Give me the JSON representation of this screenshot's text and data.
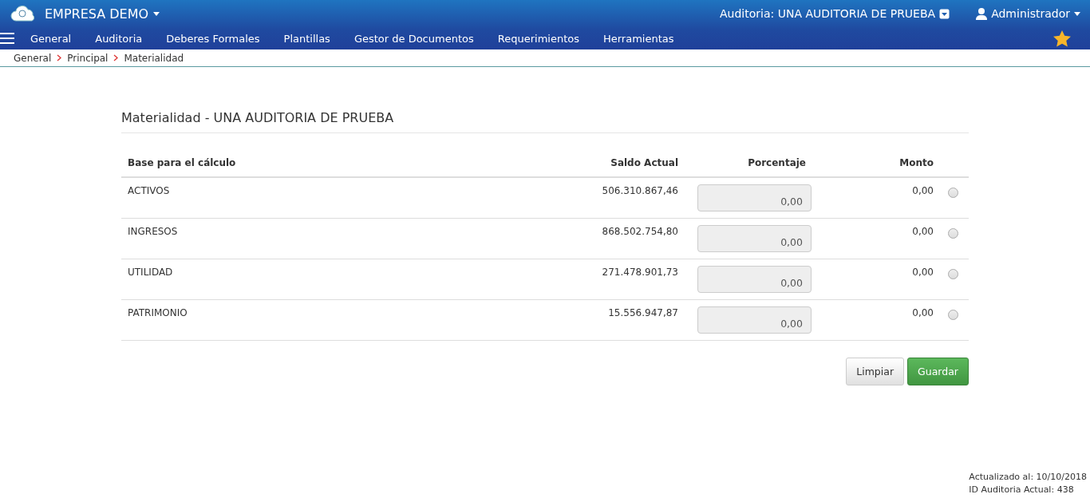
{
  "header": {
    "company": "EMPRESA DEMO",
    "audit": "Auditoria: UNA AUDITORIA DE PRUEBA",
    "user": "Administrador"
  },
  "menu": [
    "General",
    "Auditoria",
    "Deberes Formales",
    "Plantillas",
    "Gestor de Documentos",
    "Requerimientos",
    "Herramientas"
  ],
  "breadcrumb": [
    "General",
    "Principal",
    "Materialidad"
  ],
  "title": "Materialidad - UNA AUDITORIA DE PRUEBA",
  "table": {
    "columns": [
      "Base para el cálculo",
      "Saldo Actual",
      "Porcentaje",
      "Monto"
    ],
    "rows": [
      {
        "base": "ACTIVOS",
        "saldo": "506.310.867,46",
        "porcentaje": "0,00",
        "monto": "0,00",
        "selected": false
      },
      {
        "base": "INGRESOS",
        "saldo": "868.502.754,80",
        "porcentaje": "0,00",
        "monto": "0,00",
        "selected": false
      },
      {
        "base": "UTILIDAD",
        "saldo": "271.478.901,73",
        "porcentaje": "0,00",
        "monto": "0,00",
        "selected": false
      },
      {
        "base": "PATRIMONIO",
        "saldo": "15.556.947,87",
        "porcentaje": "0,00",
        "monto": "0,00",
        "selected": false
      }
    ]
  },
  "buttons": [
    "Limpiar",
    "Guardar"
  ],
  "footer": [
    "Actualizado al: 10/10/2018",
    "ID Auditoria Actual: 438"
  ]
}
